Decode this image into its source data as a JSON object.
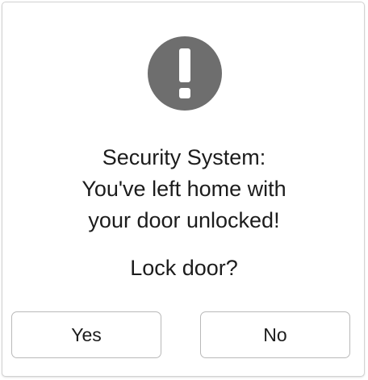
{
  "dialog": {
    "icon": "exclamation-circle-icon",
    "icon_color": "#6e6e6e",
    "message_lines": [
      "Security System:",
      "You've left home with",
      "your door unlocked!"
    ],
    "question": "Lock door?",
    "buttons": {
      "yes_label": "Yes",
      "no_label": "No"
    }
  }
}
